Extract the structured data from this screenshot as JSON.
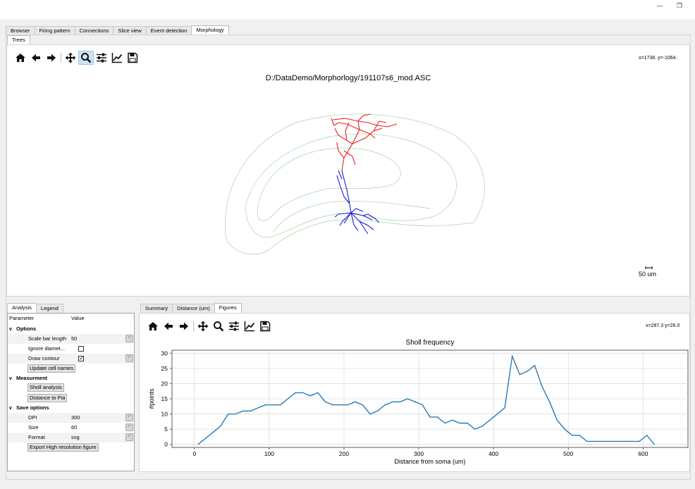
{
  "window": {
    "minimize_glyph": "—",
    "restore_glyph": "❐"
  },
  "main_tabs": [
    {
      "label": "Browser"
    },
    {
      "label": "Firing pattern"
    },
    {
      "label": "Connections"
    },
    {
      "label": "Slice view"
    },
    {
      "label": "Event detection"
    },
    {
      "label": "Morphology"
    }
  ],
  "sub_tabs": [
    {
      "label": "Trees"
    }
  ],
  "trees_view": {
    "coords": "x=1738. y=-1064.",
    "figure_title": "D:/DataDemo/Morphorlogy/191107s6_mod.ASC",
    "scalebar_label": "50 um",
    "apical_color": "#e82020",
    "basal_color": "#1a1ae0",
    "contour_color": "#a8d4a8"
  },
  "toolbar_icons": [
    "home-icon",
    "back-icon",
    "forward-icon",
    "pan-icon",
    "zoom-icon",
    "configure-icon",
    "edit-axes-icon",
    "save-icon"
  ],
  "left_tabs": [
    {
      "label": "Analysis"
    },
    {
      "label": "Legend"
    }
  ],
  "param_table": {
    "header_param": "Parameter",
    "header_value": "Value",
    "options_group": "Options",
    "scale_bar_label": "Scale bar length",
    "scale_bar_value": "50",
    "ignore_diam_label": "Ignore diamet...",
    "draw_contour_label": "Draw contour",
    "draw_contour_check": "✓",
    "update_names_button": "Update cell names",
    "measurement_group": "Measurment",
    "sholl_button": "Sholl analysis",
    "pia_button": "Distance to Pia",
    "save_group": "Save options",
    "dpi_label": "DPI",
    "dpi_value": "300",
    "size_label": "Size",
    "size_value": "60",
    "format_label": "Format",
    "format_value": "svg",
    "export_button": "Export High resolution figure",
    "reset_glyph": "↶",
    "chevron": "v"
  },
  "right_tabs": [
    {
      "label": "Summary"
    },
    {
      "label": "Distance (um)"
    },
    {
      "label": "Figures"
    }
  ],
  "sholl_view": {
    "coords": "x=287.3 y=26.0"
  },
  "chart_data": {
    "type": "line",
    "title": "Sholl frequency",
    "xlabel": "Distance from soma (um)",
    "ylabel": "#points",
    "xlim": [
      -30,
      660
    ],
    "ylim": [
      -1,
      31
    ],
    "xticks": [
      0,
      100,
      200,
      300,
      400,
      500,
      600
    ],
    "yticks": [
      0,
      5,
      10,
      15,
      20,
      25,
      30
    ],
    "grid": true,
    "line_color": "#2b7bb4",
    "x": [
      5,
      15,
      25,
      35,
      45,
      55,
      65,
      75,
      85,
      95,
      105,
      115,
      125,
      135,
      145,
      155,
      165,
      175,
      185,
      195,
      205,
      215,
      225,
      235,
      245,
      255,
      265,
      275,
      285,
      295,
      305,
      315,
      325,
      335,
      345,
      355,
      365,
      375,
      385,
      395,
      405,
      415,
      425,
      435,
      445,
      455,
      465,
      475,
      485,
      495,
      505,
      515,
      525,
      535,
      545,
      555,
      565,
      575,
      585,
      595,
      605,
      615
    ],
    "y": [
      0,
      2,
      4,
      6,
      10,
      10,
      11,
      11,
      12,
      13,
      13,
      13,
      15,
      17,
      17,
      16,
      17,
      14,
      13,
      13,
      13,
      14,
      13,
      10,
      11,
      13,
      14,
      14,
      15,
      14,
      13,
      9,
      9,
      7,
      8,
      7,
      7,
      5,
      6,
      8,
      10,
      12,
      29,
      23,
      24,
      26,
      19,
      14,
      8,
      5,
      3,
      3,
      1,
      1,
      1,
      1,
      1,
      1,
      1,
      1,
      3,
      0
    ]
  }
}
